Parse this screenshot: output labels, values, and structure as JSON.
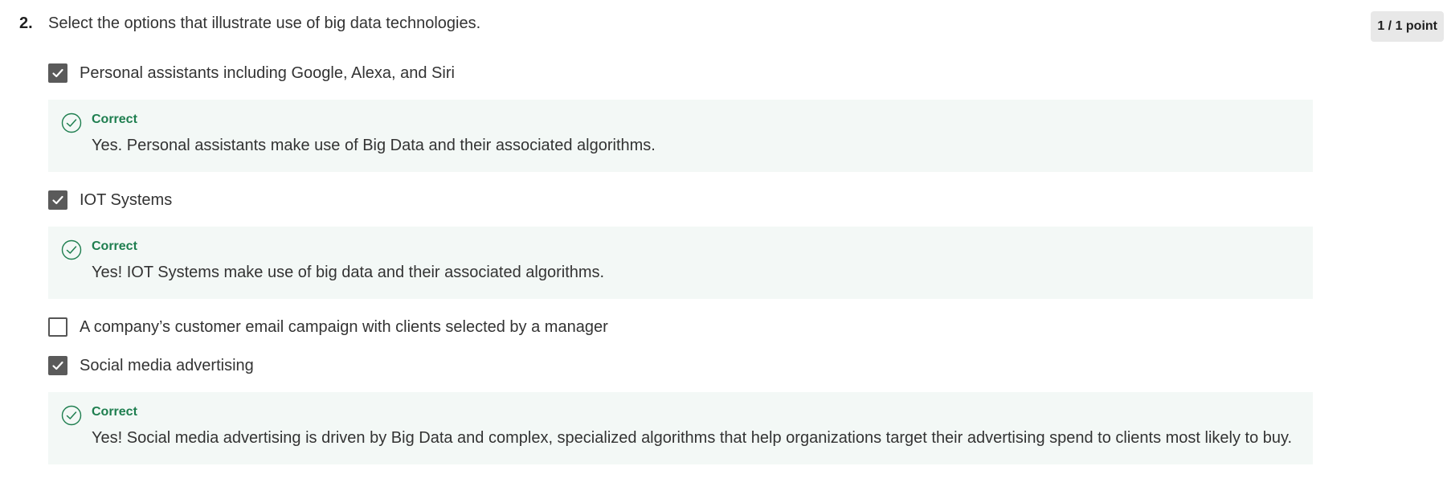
{
  "question": {
    "number": "2.",
    "text": "Select the options that illustrate use of big data technologies.",
    "points": "1 / 1 point"
  },
  "options": [
    {
      "label": "Personal assistants including Google, Alexa, and Siri",
      "checked": true,
      "feedback": {
        "status": "Correct",
        "text": "Yes. Personal assistants make use of Big Data and their associated algorithms."
      }
    },
    {
      "label": "IOT Systems",
      "checked": true,
      "feedback": {
        "status": "Correct",
        "text": "Yes! IOT Systems make use of big data and their associated algorithms."
      }
    },
    {
      "label": "A company’s customer email campaign with clients selected by a manager",
      "checked": false
    },
    {
      "label": "Social media advertising",
      "checked": true,
      "feedback": {
        "status": "Correct",
        "text": "Yes! Social media advertising is driven by Big Data and complex, specialized algorithms that help organizations target their advertising spend to clients most likely to buy."
      }
    }
  ],
  "colors": {
    "correct_green": "#1e7e4f",
    "feedback_bg": "#f3f8f6",
    "checkbox_checked": "#5a5a5a",
    "points_badge_bg": "#e8e8e8"
  },
  "icons": {
    "checkbox_checked": "check-icon",
    "feedback_correct": "check-circle-icon"
  }
}
